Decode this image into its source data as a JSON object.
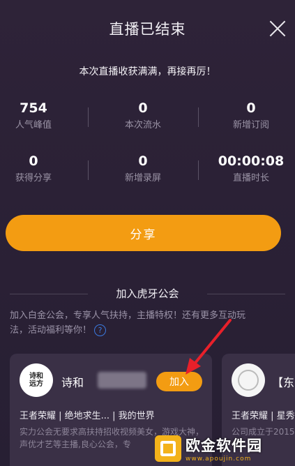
{
  "header": {
    "title": "直播已结束"
  },
  "subtitle": "本次直播收获满满，再接再厉！",
  "stats": [
    [
      {
        "value": "754",
        "label": "人气峰值"
      },
      {
        "value": "0",
        "label": "本次流水"
      },
      {
        "value": "0",
        "label": "新增订阅"
      }
    ],
    [
      {
        "value": "0",
        "label": "获得分享"
      },
      {
        "value": "0",
        "label": "新增录屏"
      },
      {
        "value": "00:00:08",
        "label": "直播时长"
      }
    ]
  ],
  "share_button": "分享",
  "guild": {
    "section_title": "加入虎牙公会",
    "description": "加入白金公会，专享人气扶持，主播特权！还有更多互动玩法，活动福利等你！",
    "help_icon": "?",
    "cards": [
      {
        "name": "诗和",
        "join_label": "加入",
        "games": "王者荣耀 | 绝地求生... | 我的世界",
        "desc": "实力公会无要求高扶持招收视频美女，游戏大神，声优才艺等主播,良心公会，专"
      },
      {
        "name": "【东",
        "games": "王者荣耀 | 星秀",
        "desc": "公司成立于2015"
      }
    ]
  },
  "watermark": {
    "title": "欧金软件园",
    "url": "www.apoujin.com"
  },
  "colors": {
    "accent": "#f39c12",
    "background": "#2b2136",
    "card": "#3a3046"
  }
}
